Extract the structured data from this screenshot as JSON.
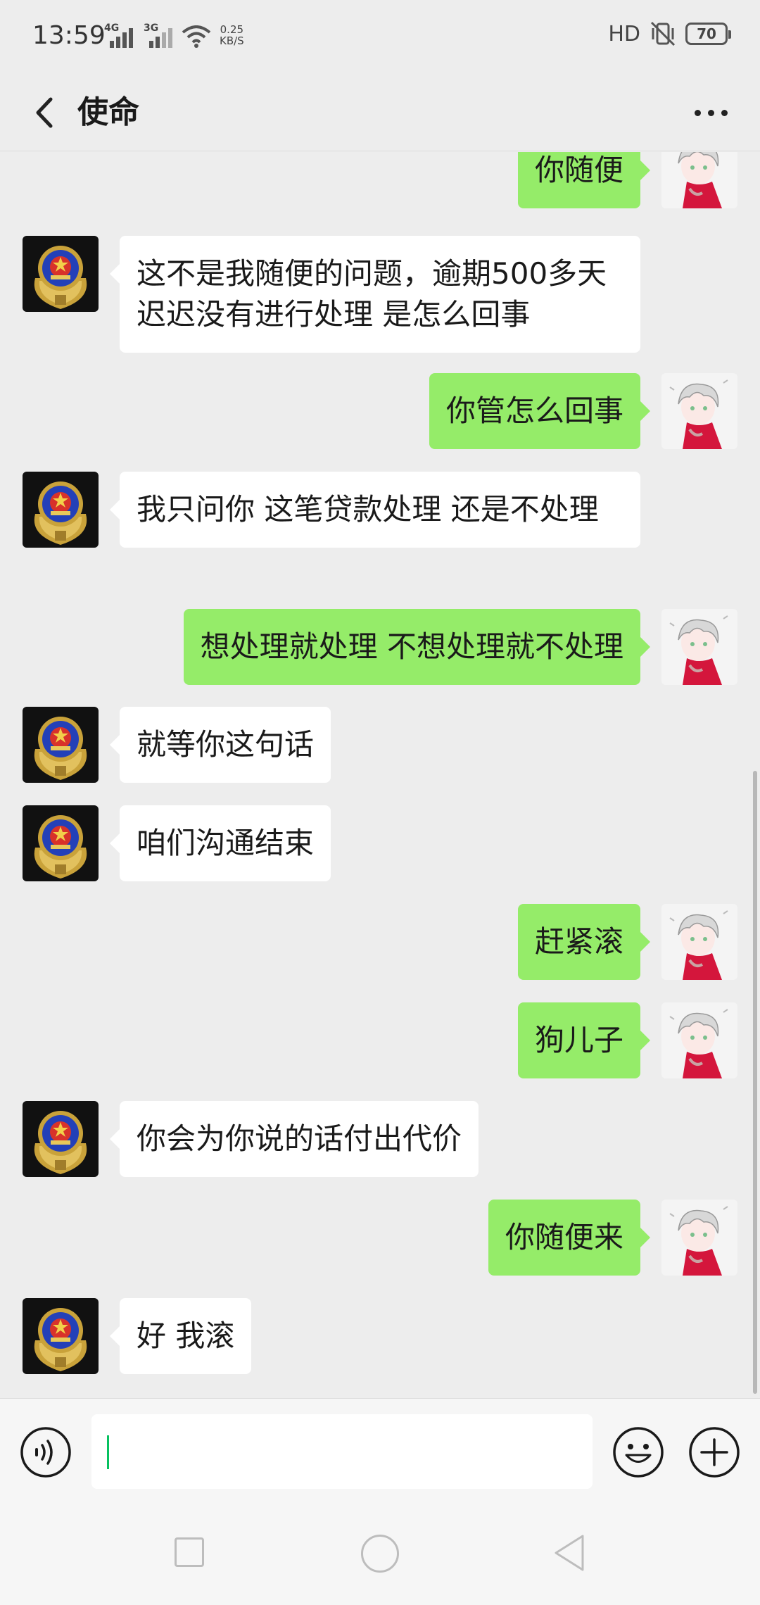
{
  "status_bar": {
    "time": "13:59",
    "network1": "4G",
    "network2": "3G",
    "speed_value": "0.25",
    "speed_unit": "KB/S",
    "hd": "HD",
    "battery": "70"
  },
  "header": {
    "title": "使命",
    "back_icon": "chevron-left-icon",
    "more_icon": "more-dots-icon"
  },
  "messages": [
    {
      "side": "right",
      "text": "你随便"
    },
    {
      "side": "left",
      "text": "这不是我随便的问题，逾期500多天  迟迟没有进行处理 是怎么回事"
    },
    {
      "side": "right",
      "text": "你管怎么回事"
    },
    {
      "side": "left",
      "text": "我只问你  这笔贷款处理 还是不处理"
    },
    {
      "side": "right",
      "text": "想处理就处理  不想处理就不处理"
    },
    {
      "side": "left",
      "text": "就等你这句话"
    },
    {
      "side": "left",
      "text": "咱们沟通结束"
    },
    {
      "side": "right",
      "text": "赶紧滚"
    },
    {
      "side": "right",
      "text": "狗儿子"
    },
    {
      "side": "left",
      "text": "你会为你说的话付出代价"
    },
    {
      "side": "right",
      "text": "你随便来"
    },
    {
      "side": "left",
      "text": "好  我滚"
    }
  ],
  "input_bar": {
    "voice_icon": "voice-icon",
    "input_value": "",
    "emoji_icon": "emoji-icon",
    "plus_icon": "plus-icon"
  },
  "colors": {
    "background": "#ededed",
    "sent_bubble": "#95ec69",
    "received_bubble": "#ffffff",
    "caret": "#07c160"
  }
}
